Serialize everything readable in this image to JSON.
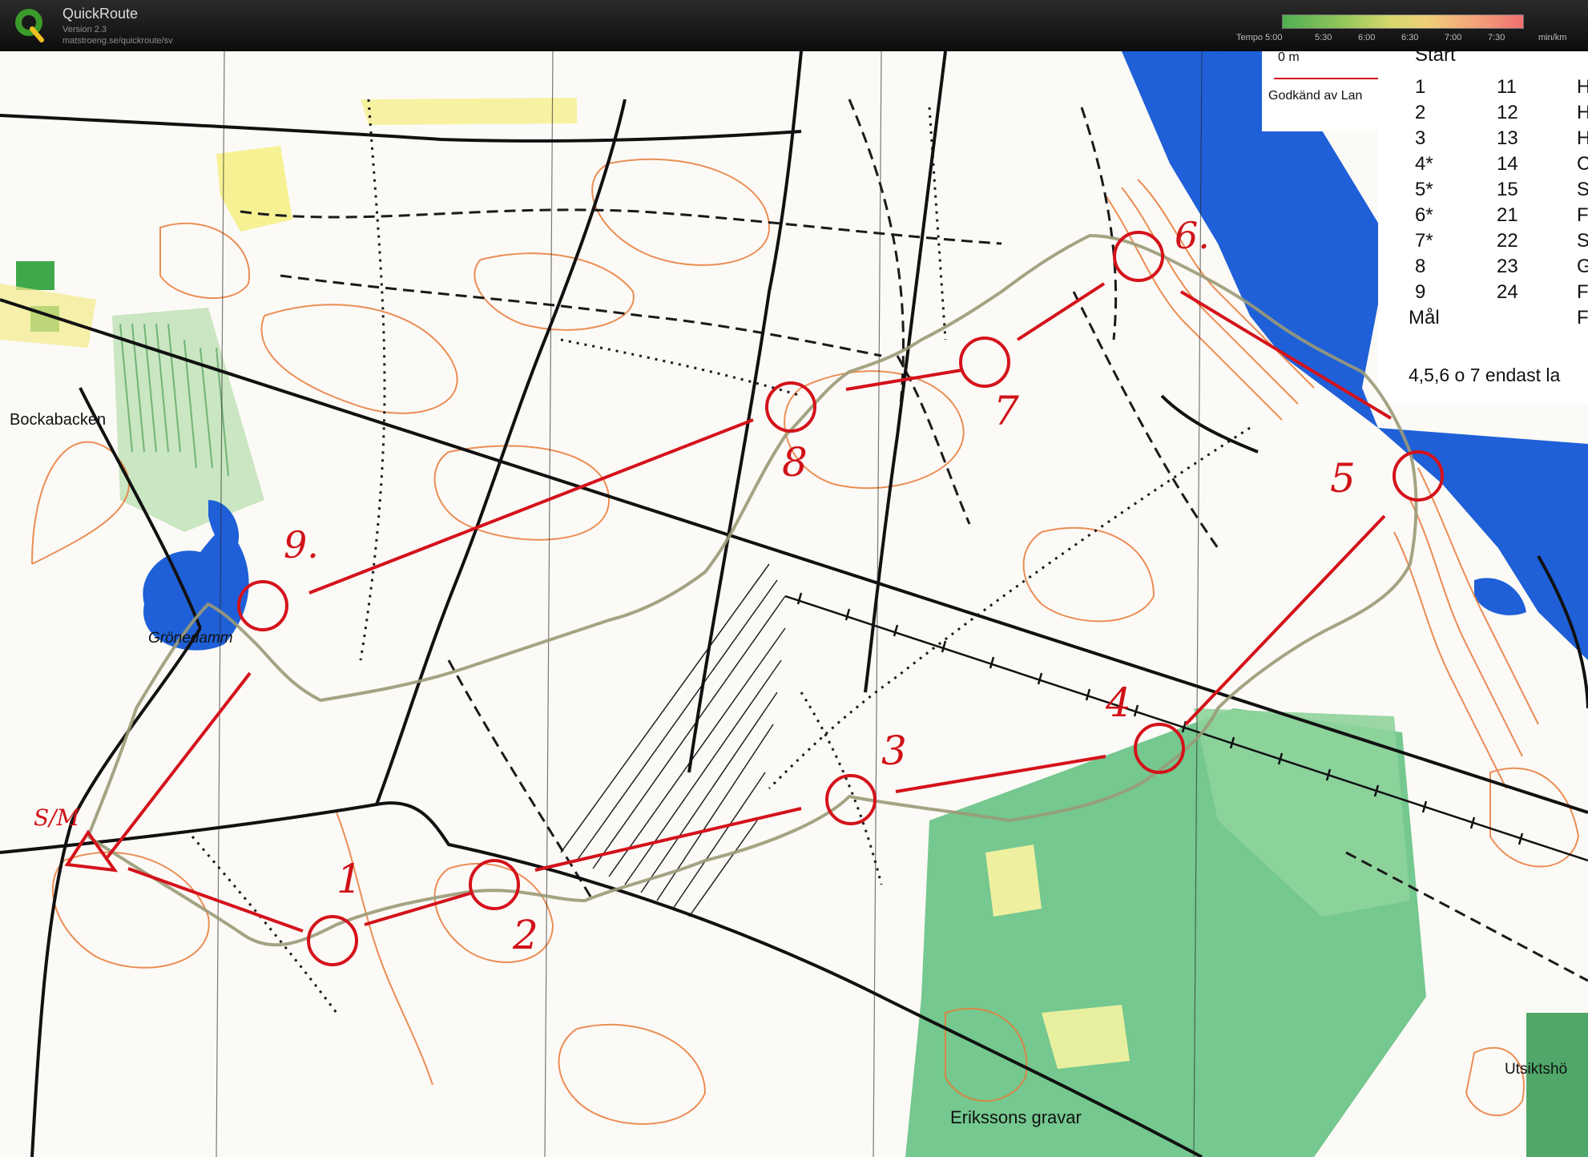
{
  "header": {
    "title": "QuickRoute",
    "version": "Version 2.3",
    "url": "matstroeng.se/quickroute/sv",
    "tempo_labels": [
      "Tempo 5:00",
      "5:30",
      "6:00",
      "6:30",
      "7:00",
      "7:30",
      "min/km"
    ]
  },
  "colors": {
    "route_line": "#d4121b",
    "gps_track": "#9a9a78",
    "water": "#1f60d8",
    "forest_green": "#5dbe7c",
    "open_yellow": "#f4ec6a",
    "contour": "#e87a3a"
  },
  "map": {
    "place_names": {
      "bockabacken": "Bockabacken",
      "gronedamm": "Grönedamm",
      "erikssons_gravar": "Erikssons gravar",
      "utsiktshojd": "Utsiktshö",
      "godkand": "Godkänd av Lan",
      "scale_marker": "0 m"
    },
    "control_labels": {
      "start": "S/M",
      "c1": "1",
      "c2": "2",
      "c3": "3",
      "c4": "4",
      "c5": "5",
      "c6": "6.",
      "c7": "7",
      "c8": "8",
      "c9": "9."
    },
    "legend": {
      "start": "Start",
      "finish": "Mål",
      "note": "4,5,6 o 7 endast la",
      "rows": [
        {
          "a": "1",
          "b": "11",
          "c": "H"
        },
        {
          "a": "2",
          "b": "12",
          "c": "H"
        },
        {
          "a": "3",
          "b": "13",
          "c": "H"
        },
        {
          "a": "4*",
          "b": "14",
          "c": "C"
        },
        {
          "a": "5*",
          "b": "15",
          "c": "S"
        },
        {
          "a": "6*",
          "b": "21",
          "c": "F"
        },
        {
          "a": "7*",
          "b": "22",
          "c": "S"
        },
        {
          "a": "8",
          "b": "23",
          "c": "G"
        },
        {
          "a": "9",
          "b": "24",
          "c": "F"
        }
      ],
      "finish_col_c": "F"
    }
  }
}
